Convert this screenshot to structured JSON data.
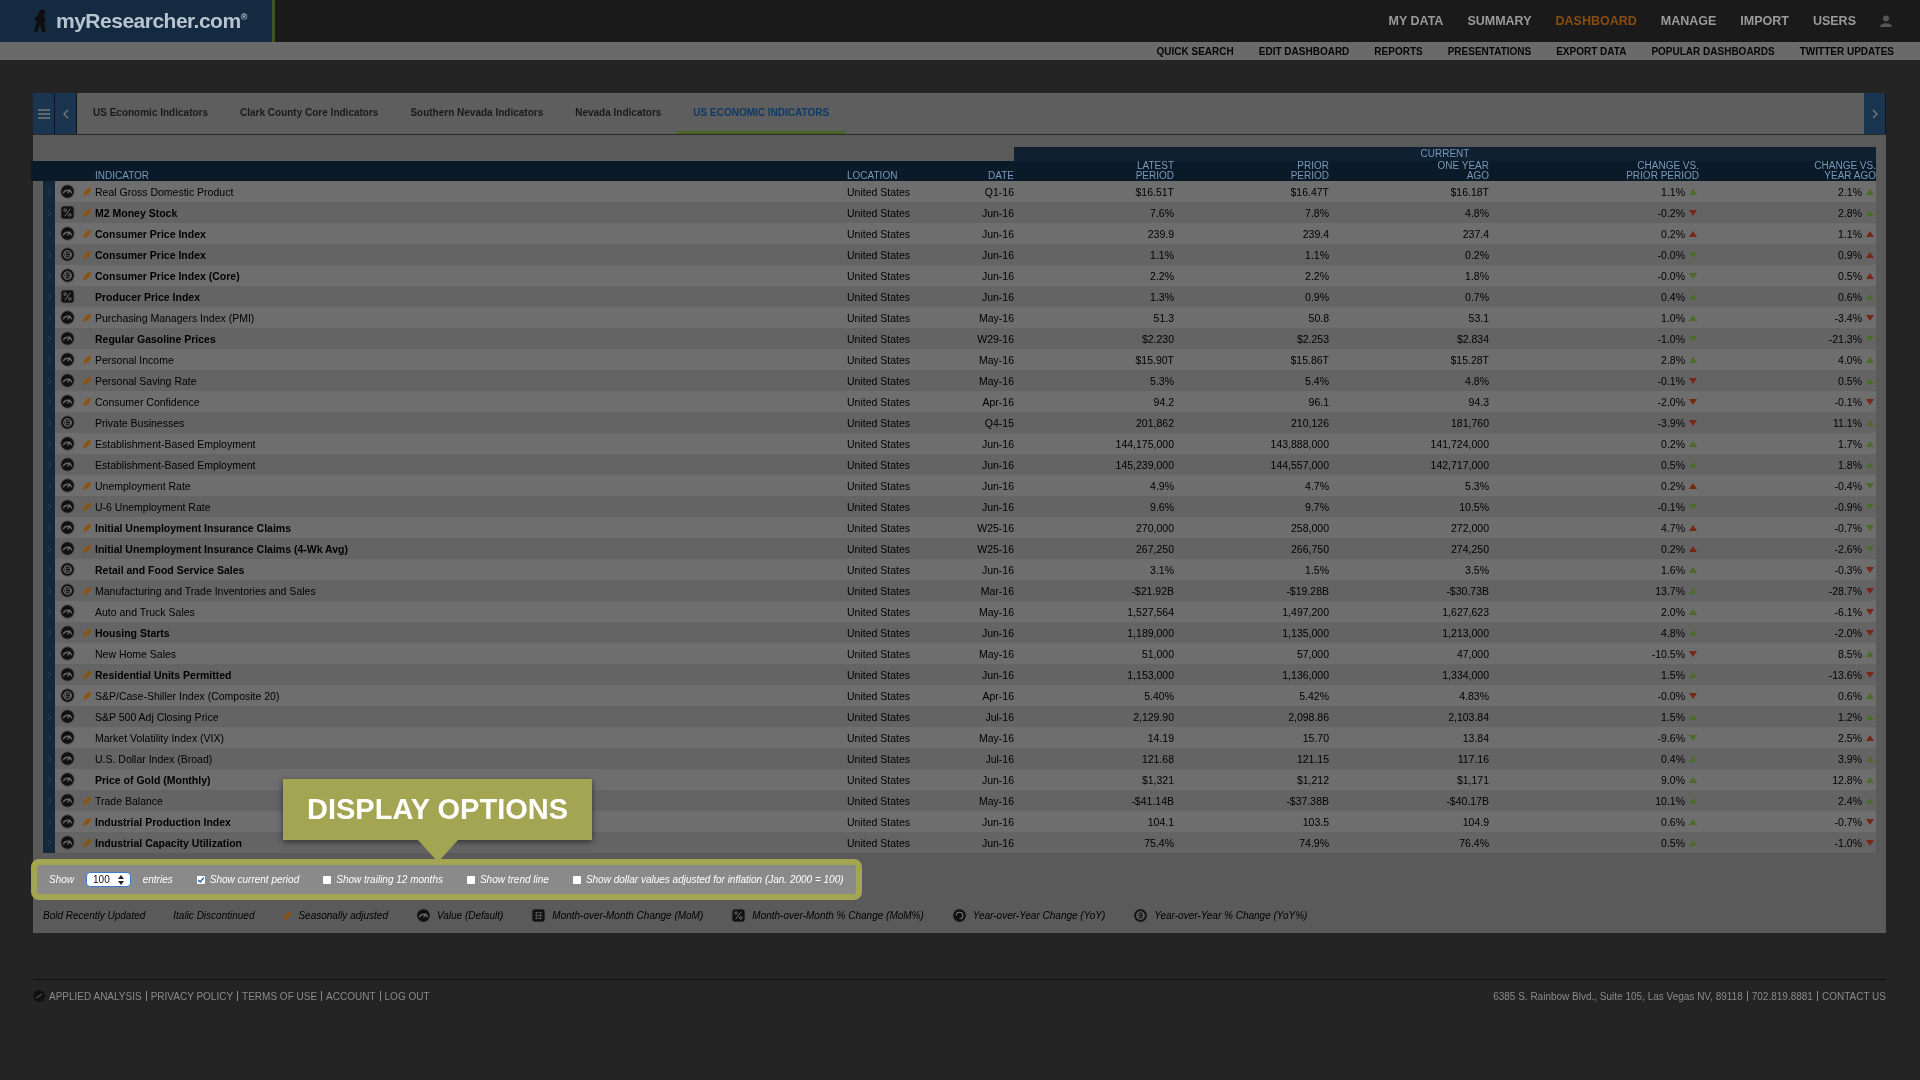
{
  "header": {
    "logo": "myResearcher.com",
    "logo_mark": "®",
    "nav": [
      {
        "label": "MY DATA",
        "selected": false
      },
      {
        "label": "SUMMARY",
        "selected": false
      },
      {
        "label": "DASHBOARD",
        "selected": true
      },
      {
        "label": "MANAGE",
        "selected": false
      },
      {
        "label": "IMPORT",
        "selected": false
      },
      {
        "label": "USERS",
        "selected": false
      }
    ],
    "subnav": [
      "QUICK SEARCH",
      "EDIT DASHBOARD",
      "REPORTS",
      "PRESENTATIONS",
      "EXPORT DATA",
      "POPULAR DASHBOARDS",
      "TWITTER UPDATES"
    ]
  },
  "tabs": [
    {
      "label": "US Economic Indicators",
      "selected": false
    },
    {
      "label": "Clark County Core Indicators",
      "selected": false
    },
    {
      "label": "Southern Nevada Indicators",
      "selected": false
    },
    {
      "label": "Nevada Indicators",
      "selected": false
    },
    {
      "label": "US ECONOMIC INDICATORS",
      "selected": true
    }
  ],
  "table": {
    "group_heading": "CURRENT",
    "columns": [
      "INDICATOR",
      "LOCATION",
      "DATE",
      "LATEST\nPERIOD",
      "PRIOR\nPERIOD",
      "ONE YEAR\nAGO",
      "CHANGE VS.\nPRIOR PERIOD",
      "CHANGE VS.\nYEAR AGO"
    ],
    "rows": [
      {
        "kind": "value",
        "seasonal": true,
        "bold": false,
        "indicator": "Real Gross Domestic Product",
        "location": "United States",
        "date": "Q1-16",
        "latest": "$16.51T",
        "prior": "$16.47T",
        "year_ago": "$16.18T",
        "chg_prior": "1.1%",
        "prior_up": true,
        "prior_good": true,
        "chg_year": "2.1%",
        "year_up": true,
        "year_good": true
      },
      {
        "kind": "mom_pct",
        "seasonal": true,
        "bold": true,
        "indicator": "M2 Money Stock",
        "location": "United States",
        "date": "Jun-16",
        "latest": "7.6%",
        "prior": "7.8%",
        "year_ago": "4.8%",
        "chg_prior": "-0.2%",
        "prior_up": false,
        "prior_good": false,
        "chg_year": "2.8%",
        "year_up": true,
        "year_good": true
      },
      {
        "kind": "value",
        "seasonal": true,
        "bold": true,
        "indicator": "Consumer Price Index",
        "location": "United States",
        "date": "Jun-16",
        "latest": "239.9",
        "prior": "239.4",
        "year_ago": "237.4",
        "chg_prior": "0.2%",
        "prior_up": true,
        "prior_good": false,
        "chg_year": "1.1%",
        "year_up": true,
        "year_good": false
      },
      {
        "kind": "yoy_pct",
        "seasonal": true,
        "bold": true,
        "indicator": "Consumer Price Index",
        "location": "United States",
        "date": "Jun-16",
        "latest": "1.1%",
        "prior": "1.1%",
        "year_ago": "0.2%",
        "chg_prior": "-0.0%",
        "prior_up": false,
        "prior_good": true,
        "chg_year": "0.9%",
        "year_up": true,
        "year_good": false
      },
      {
        "kind": "yoy_pct",
        "seasonal": true,
        "bold": true,
        "indicator": "Consumer Price Index (Core)",
        "location": "United States",
        "date": "Jun-16",
        "latest": "2.2%",
        "prior": "2.2%",
        "year_ago": "1.8%",
        "chg_prior": "-0.0%",
        "prior_up": false,
        "prior_good": true,
        "chg_year": "0.5%",
        "year_up": true,
        "year_good": false
      },
      {
        "kind": "mom_pct",
        "seasonal": false,
        "bold": true,
        "indicator": "Producer Price Index",
        "location": "United States",
        "date": "Jun-16",
        "latest": "1.3%",
        "prior": "0.9%",
        "year_ago": "0.7%",
        "chg_prior": "0.4%",
        "prior_up": true,
        "prior_good": true,
        "chg_year": "0.6%",
        "year_up": true,
        "year_good": true
      },
      {
        "kind": "value",
        "seasonal": true,
        "bold": false,
        "indicator": "Purchasing Managers Index (PMI)",
        "location": "United States",
        "date": "May-16",
        "latest": "51.3",
        "prior": "50.8",
        "year_ago": "53.1",
        "chg_prior": "1.0%",
        "prior_up": true,
        "prior_good": true,
        "chg_year": "-3.4%",
        "year_up": false,
        "year_good": false
      },
      {
        "kind": "value",
        "seasonal": false,
        "bold": true,
        "indicator": "Regular Gasoline Prices",
        "location": "United States",
        "date": "W29-16",
        "latest": "$2.230",
        "prior": "$2.253",
        "year_ago": "$2.834",
        "chg_prior": "-1.0%",
        "prior_up": false,
        "prior_good": true,
        "chg_year": "-21.3%",
        "year_up": false,
        "year_good": true
      },
      {
        "kind": "value",
        "seasonal": true,
        "bold": false,
        "indicator": "Personal Income",
        "location": "United States",
        "date": "May-16",
        "latest": "$15.90T",
        "prior": "$15.86T",
        "year_ago": "$15.28T",
        "chg_prior": "2.8%",
        "prior_up": true,
        "prior_good": true,
        "chg_year": "4.0%",
        "year_up": true,
        "year_good": true
      },
      {
        "kind": "value",
        "seasonal": true,
        "bold": false,
        "indicator": "Personal Saving Rate",
        "location": "United States",
        "date": "May-16",
        "latest": "5.3%",
        "prior": "5.4%",
        "year_ago": "4.8%",
        "chg_prior": "-0.1%",
        "prior_up": false,
        "prior_good": false,
        "chg_year": "0.5%",
        "year_up": true,
        "year_good": true
      },
      {
        "kind": "value",
        "seasonal": true,
        "bold": false,
        "indicator": "Consumer Confidence",
        "location": "United States",
        "date": "Apr-16",
        "latest": "94.2",
        "prior": "96.1",
        "year_ago": "94.3",
        "chg_prior": "-2.0%",
        "prior_up": false,
        "prior_good": false,
        "chg_year": "-0.1%",
        "year_up": false,
        "year_good": false
      },
      {
        "kind": "yoy_pct",
        "seasonal": false,
        "bold": false,
        "indicator": "Private Businesses",
        "location": "United States",
        "date": "Q4-15",
        "latest": "201,862",
        "prior": "210,126",
        "year_ago": "181,760",
        "chg_prior": "-3.9%",
        "prior_up": false,
        "prior_good": false,
        "chg_year": "11.1%",
        "year_up": true,
        "year_good": true
      },
      {
        "kind": "value",
        "seasonal": true,
        "bold": false,
        "indicator": "Establishment-Based Employment",
        "location": "United States",
        "date": "Jun-16",
        "latest": "144,175,000",
        "prior": "143,888,000",
        "year_ago": "141,724,000",
        "chg_prior": "0.2%",
        "prior_up": true,
        "prior_good": true,
        "chg_year": "1.7%",
        "year_up": true,
        "year_good": true
      },
      {
        "kind": "value",
        "seasonal": false,
        "bold": false,
        "indicator": "Establishment-Based Employment",
        "location": "United States",
        "date": "Jun-16",
        "latest": "145,239,000",
        "prior": "144,557,000",
        "year_ago": "142,717,000",
        "chg_prior": "0.5%",
        "prior_up": true,
        "prior_good": true,
        "chg_year": "1.8%",
        "year_up": true,
        "year_good": true
      },
      {
        "kind": "value",
        "seasonal": true,
        "bold": false,
        "indicator": "Unemployment Rate",
        "location": "United States",
        "date": "Jun-16",
        "latest": "4.9%",
        "prior": "4.7%",
        "year_ago": "5.3%",
        "chg_prior": "0.2%",
        "prior_up": true,
        "prior_good": false,
        "chg_year": "-0.4%",
        "year_up": false,
        "year_good": true
      },
      {
        "kind": "value",
        "seasonal": true,
        "bold": false,
        "indicator": "U-6 Unemployment Rate",
        "location": "United States",
        "date": "Jun-16",
        "latest": "9.6%",
        "prior": "9.7%",
        "year_ago": "10.5%",
        "chg_prior": "-0.1%",
        "prior_up": false,
        "prior_good": true,
        "chg_year": "-0.9%",
        "year_up": false,
        "year_good": true
      },
      {
        "kind": "value",
        "seasonal": true,
        "bold": true,
        "indicator": "Initial Unemployment Insurance Claims",
        "location": "United States",
        "date": "W25-16",
        "latest": "270,000",
        "prior": "258,000",
        "year_ago": "272,000",
        "chg_prior": "4.7%",
        "prior_up": true,
        "prior_good": false,
        "chg_year": "-0.7%",
        "year_up": false,
        "year_good": true
      },
      {
        "kind": "value",
        "seasonal": true,
        "bold": true,
        "indicator": "Initial Unemployment Insurance Claims (4-Wk Avg)",
        "location": "United States",
        "date": "W25-16",
        "latest": "267,250",
        "prior": "266,750",
        "year_ago": "274,250",
        "chg_prior": "0.2%",
        "prior_up": true,
        "prior_good": false,
        "chg_year": "-2.6%",
        "year_up": false,
        "year_good": true
      },
      {
        "kind": "yoy_pct",
        "seasonal": false,
        "bold": true,
        "indicator": "Retail and Food Service Sales",
        "location": "United States",
        "date": "Jun-16",
        "latest": "3.1%",
        "prior": "1.5%",
        "year_ago": "3.5%",
        "chg_prior": "1.6%",
        "prior_up": true,
        "prior_good": true,
        "chg_year": "-0.3%",
        "year_up": false,
        "year_good": false
      },
      {
        "kind": "yoy_pct",
        "seasonal": true,
        "bold": false,
        "indicator": "Manufacturing and Trade Inventories and Sales",
        "location": "United States",
        "date": "Mar-16",
        "latest": "-$21.92B",
        "prior": "-$19.28B",
        "year_ago": "-$30.73B",
        "chg_prior": "13.7%",
        "prior_up": true,
        "prior_good": true,
        "chg_year": "-28.7%",
        "year_up": false,
        "year_good": false
      },
      {
        "kind": "value",
        "seasonal": false,
        "bold": false,
        "indicator": "Auto and Truck Sales",
        "location": "United States",
        "date": "May-16",
        "latest": "1,527,564",
        "prior": "1,497,200",
        "year_ago": "1,627,623",
        "chg_prior": "2.0%",
        "prior_up": true,
        "prior_good": true,
        "chg_year": "-6.1%",
        "year_up": false,
        "year_good": false
      },
      {
        "kind": "value",
        "seasonal": true,
        "bold": true,
        "indicator": "Housing Starts",
        "location": "United States",
        "date": "Jun-16",
        "latest": "1,189,000",
        "prior": "1,135,000",
        "year_ago": "1,213,000",
        "chg_prior": "4.8%",
        "prior_up": true,
        "prior_good": true,
        "chg_year": "-2.0%",
        "year_up": false,
        "year_good": false
      },
      {
        "kind": "value",
        "seasonal": false,
        "bold": false,
        "indicator": "New Home Sales",
        "location": "United States",
        "date": "May-16",
        "latest": "51,000",
        "prior": "57,000",
        "year_ago": "47,000",
        "chg_prior": "-10.5%",
        "prior_up": false,
        "prior_good": false,
        "chg_year": "8.5%",
        "year_up": true,
        "year_good": true
      },
      {
        "kind": "value",
        "seasonal": true,
        "bold": true,
        "indicator": "Residential Units Permitted",
        "location": "United States",
        "date": "Jun-16",
        "latest": "1,153,000",
        "prior": "1,136,000",
        "year_ago": "1,334,000",
        "chg_prior": "1.5%",
        "prior_up": true,
        "prior_good": true,
        "chg_year": "-13.6%",
        "year_up": false,
        "year_good": false
      },
      {
        "kind": "yoy_pct",
        "seasonal": true,
        "bold": false,
        "indicator": "S&P/Case-Shiller Index (Composite 20)",
        "location": "United States",
        "date": "Apr-16",
        "latest": "5.40%",
        "prior": "5.42%",
        "year_ago": "4.83%",
        "chg_prior": "-0.0%",
        "prior_up": false,
        "prior_good": false,
        "chg_year": "0.6%",
        "year_up": true,
        "year_good": true
      },
      {
        "kind": "value",
        "seasonal": false,
        "bold": false,
        "indicator": "S&P 500 Adj Closing Price",
        "location": "United States",
        "date": "Jul-16",
        "latest": "2,129.90",
        "prior": "2,098.86",
        "year_ago": "2,103.84",
        "chg_prior": "1.5%",
        "prior_up": true,
        "prior_good": true,
        "chg_year": "1.2%",
        "year_up": true,
        "year_good": true
      },
      {
        "kind": "value",
        "seasonal": false,
        "bold": false,
        "indicator": "Market Volatility Index (VIX)",
        "location": "United States",
        "date": "May-16",
        "latest": "14.19",
        "prior": "15.70",
        "year_ago": "13.84",
        "chg_prior": "-9.6%",
        "prior_up": false,
        "prior_good": true,
        "chg_year": "2.5%",
        "year_up": true,
        "year_good": false
      },
      {
        "kind": "value",
        "seasonal": false,
        "bold": false,
        "indicator": "U.S. Dollar Index (Broad)",
        "location": "United States",
        "date": "Jul-16",
        "latest": "121.68",
        "prior": "121.15",
        "year_ago": "117.16",
        "chg_prior": "0.4%",
        "prior_up": true,
        "prior_good": true,
        "chg_year": "3.9%",
        "year_up": true,
        "year_good": true
      },
      {
        "kind": "value",
        "seasonal": false,
        "bold": true,
        "indicator": "Price of Gold (Monthly)",
        "location": "United States",
        "date": "Jun-16",
        "latest": "$1,321",
        "prior": "$1,212",
        "year_ago": "$1,171",
        "chg_prior": "9.0%",
        "prior_up": true,
        "prior_good": true,
        "chg_year": "12.8%",
        "year_up": true,
        "year_good": true
      },
      {
        "kind": "value",
        "seasonal": true,
        "bold": false,
        "indicator": "Trade Balance",
        "location": "United States",
        "date": "May-16",
        "latest": "-$41.14B",
        "prior": "-$37.38B",
        "year_ago": "-$40.17B",
        "chg_prior": "10.1%",
        "prior_up": true,
        "prior_good": true,
        "chg_year": "2.4%",
        "year_up": true,
        "year_good": true
      },
      {
        "kind": "value",
        "seasonal": true,
        "bold": true,
        "indicator": "Industrial Production Index",
        "location": "United States",
        "date": "Jun-16",
        "latest": "104.1",
        "prior": "103.5",
        "year_ago": "104.9",
        "chg_prior": "0.6%",
        "prior_up": true,
        "prior_good": true,
        "chg_year": "-0.7%",
        "year_up": false,
        "year_good": false
      },
      {
        "kind": "value",
        "seasonal": true,
        "bold": true,
        "indicator": "Industrial Capacity Utilization",
        "location": "United States",
        "date": "Jun-16",
        "latest": "75.4%",
        "prior": "74.9%",
        "year_ago": "76.4%",
        "chg_prior": "0.5%",
        "prior_up": true,
        "prior_good": true,
        "chg_year": "-1.0%",
        "year_up": false,
        "year_good": false
      }
    ]
  },
  "callout": "DISPLAY OPTIONS",
  "display_options": {
    "show_label": "Show",
    "entries": "100",
    "entries_label": "entries",
    "checkboxes": [
      {
        "label": "Show current period",
        "checked": true
      },
      {
        "label": "Show trailing 12 months",
        "checked": false
      },
      {
        "label": "Show trend line",
        "checked": false
      },
      {
        "label": "Show dollar values adjusted for inflation (Jan. 2000 = 100)",
        "checked": false
      }
    ]
  },
  "legend": [
    {
      "kind": "bold",
      "label": "Bold Recently Updated"
    },
    {
      "kind": "italic",
      "label": "Italic Discontinued"
    },
    {
      "kind": "seasonal",
      "label": "Seasonally adjusted"
    },
    {
      "kind": "value",
      "label": "Value (Default)"
    },
    {
      "kind": "mom",
      "label": "Month-over-Month Change (MoM)"
    },
    {
      "kind": "mom_pct",
      "label": "Month-over-Month % Change (MoM%)"
    },
    {
      "kind": "yoy",
      "label": "Year-over-Year Change (YoY)"
    },
    {
      "kind": "yoy_pct",
      "label": "Year-over-Year % Change (YoY%)"
    }
  ],
  "footer": {
    "links": [
      "APPLIED ANALYSIS",
      "PRIVACY POLICY",
      "TERMS OF USE",
      "ACCOUNT",
      "LOG OUT"
    ],
    "contact": [
      "6385 S. Rainbow Blvd., Suite 105, Las Vegas NV, 89118",
      "702.819.8881",
      "CONTACT US"
    ]
  }
}
